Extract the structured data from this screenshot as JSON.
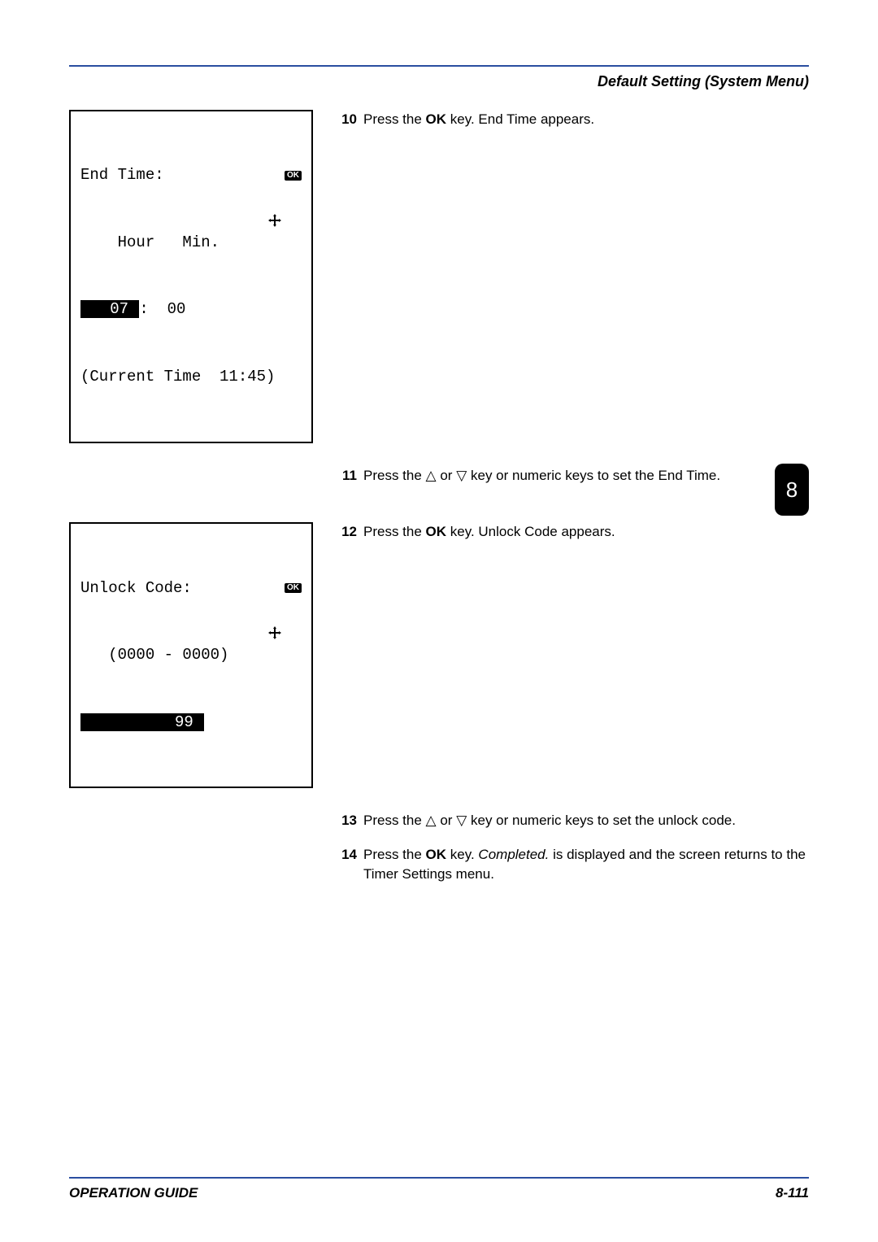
{
  "header": {
    "title": "Default Setting (System Menu)"
  },
  "lcd1": {
    "title": "End Time:",
    "ok": "OK",
    "row_labels": "    Hour   Min.",
    "hour_sel": "   07 ",
    "colon": ":",
    "min": "  00",
    "current": "(Current Time  11:45)"
  },
  "lcd2": {
    "title": "Unlock Code:",
    "ok": "OK",
    "range": "   (0000 - 0000)",
    "value_sel": "          99 "
  },
  "steps": {
    "s10_num": "10",
    "s10_a": "Press the ",
    "s10_b": "OK",
    "s10_c": " key. End Time appears.",
    "s11_num": "11",
    "s11_a": "Press the ",
    "s11_b": " or ",
    "s11_c": " key or numeric keys to set the End Time.",
    "s12_num": "12",
    "s12_a": "Press the ",
    "s12_b": "OK",
    "s12_c": " key. Unlock Code appears.",
    "s13_num": "13",
    "s13_a": "Press the ",
    "s13_b": " or ",
    "s13_c": " key or numeric keys to set the unlock code.",
    "s14_num": "14",
    "s14_a": "Press the ",
    "s14_b": "OK",
    "s14_c": " key. ",
    "s14_d": "Completed.",
    "s14_e": " is displayed and the screen returns to the Timer Settings menu."
  },
  "tab": {
    "num": "8"
  },
  "footer": {
    "left": "OPERATION GUIDE",
    "right": "8-111"
  },
  "glyph": {
    "up": "△",
    "down": "▽"
  }
}
